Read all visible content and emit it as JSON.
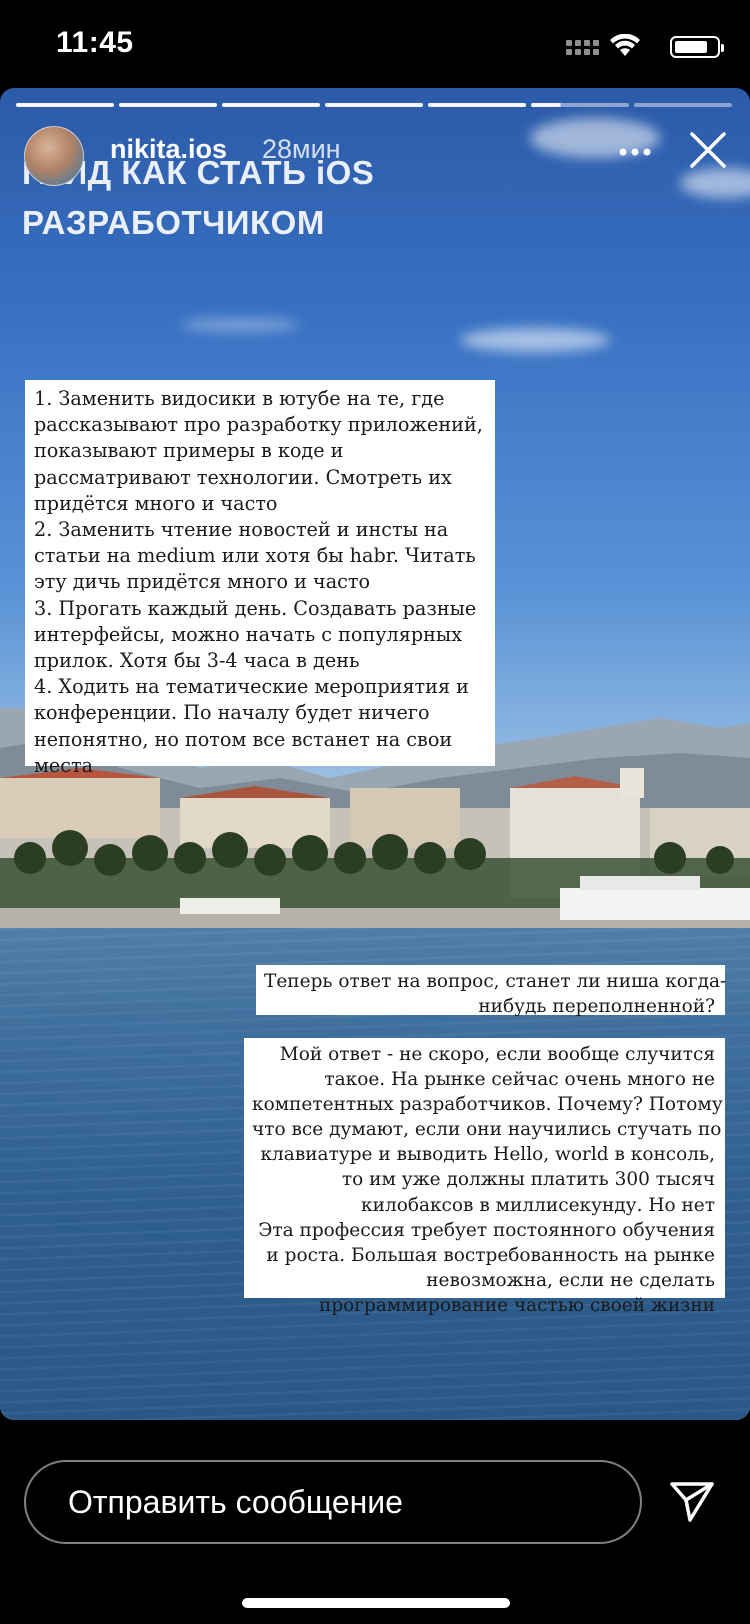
{
  "status_bar": {
    "time": "11:45",
    "icons": [
      "cellular-signal-icon",
      "wifi-icon",
      "battery-icon"
    ]
  },
  "story": {
    "progress": {
      "segments": 7,
      "completed": 5,
      "current_fraction": 0.3
    },
    "user": {
      "username": "nikita.ios",
      "time_ago": "28мин"
    },
    "headline": [
      "ГАЙД КАК СТАТЬ iOS",
      "РАЗРАБОТЧИКОМ"
    ],
    "textbox_1": {
      "lines": [
        "1. Заменить видосики в ютубе на те, где",
        "рассказывают про разработку приложений,",
        "показывают примеры в коде и",
        "рассматривают технологии. Смотреть их",
        "придётся много и часто",
        "2. Заменить чтение новостей и инсты на",
        "статьи на medium или хотя бы habr. Читать",
        "эту дичь придётся много и часто",
        "3. Прогать каждый день. Создавать разные",
        "интерфейсы, можно начать с популярных",
        "прилок. Хотя бы 3-4 часа в день",
        "4. Ходить на тематические мероприятия и",
        "конференции. По началу будет ничего",
        "непонятно, но потом все встанет на свои",
        "места"
      ]
    },
    "textbox_2": {
      "lines": [
        "Теперь ответ на вопрос, станет ли ниша когда-",
        "нибудь переполненной?"
      ]
    },
    "textbox_3": {
      "lines": [
        "Мой ответ - не скоро, если вообще случится",
        "такое. На рынке сейчас очень много не",
        "компетентных разработчиков. Почему? Потому",
        "что все думают, если они научились стучать по",
        "клавиатуре и выводить Hello, world в консоль,",
        "то им уже должны платить 300 тысяч",
        "килобаксов в миллисекунду. Но нет",
        "Эта профессия требует постоянного обучения",
        "и роста. Большая востребованность на рынке",
        "невозможна, если не сделать",
        "программирование частью своей жизни"
      ]
    },
    "more_icon": "more-dots-icon",
    "close_icon": "close-icon"
  },
  "reply": {
    "placeholder": "Отправить сообщение",
    "send_icon": "paper-plane-icon"
  },
  "colors": {
    "background": "#000000",
    "text_box": "#ffffff",
    "text_box_text": "#1a1a1a",
    "sky": "#3a73c4",
    "sea": "#2f5f8e"
  }
}
